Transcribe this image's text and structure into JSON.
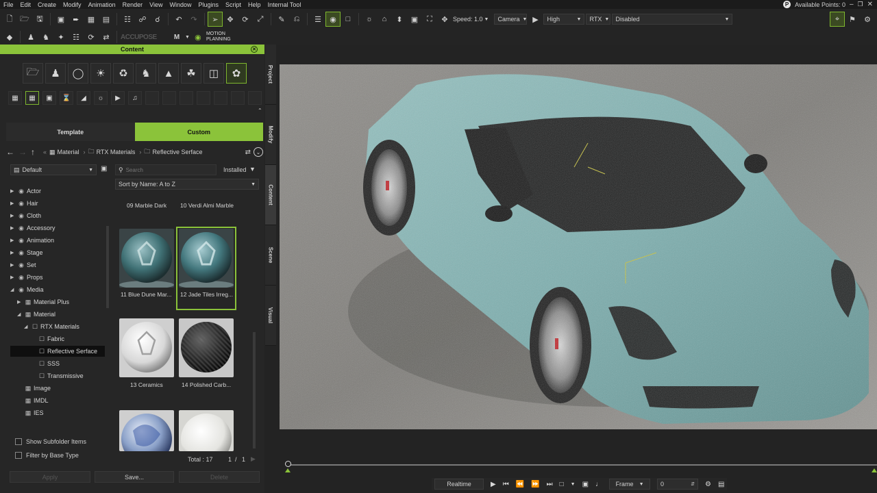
{
  "menu": [
    "File",
    "Edit",
    "Create",
    "Modify",
    "Animation",
    "Render",
    "View",
    "Window",
    "Plugins",
    "Script",
    "Help",
    "Internal Tool"
  ],
  "available_points": "Available Points: 0",
  "toolbar": {
    "speed_label": "Speed: 1.0",
    "camera": "Camera",
    "quality": "High",
    "renderer": "RTX",
    "mode": "Disabled",
    "acupose": "ACCUPOSE",
    "motion_planning": "MOTION\nPLANNING"
  },
  "panel": {
    "title": "Content",
    "tabs": [
      "Template",
      "Custom"
    ],
    "active_tab": "Custom",
    "breadcrumb": [
      "Material",
      "RTX Materials",
      "Reflective Serface"
    ],
    "filter_select": "Default",
    "search_placeholder": "Search",
    "installed_label": "Installed",
    "sort_label": "Sort by Name: A to Z",
    "tree": [
      {
        "label": "Actor",
        "indent": 0,
        "expanded": false
      },
      {
        "label": "Hair",
        "indent": 0,
        "expanded": false
      },
      {
        "label": "Cloth",
        "indent": 0,
        "expanded": false
      },
      {
        "label": "Accessory",
        "indent": 0,
        "expanded": false
      },
      {
        "label": "Animation",
        "indent": 0,
        "expanded": false
      },
      {
        "label": "Stage",
        "indent": 0,
        "expanded": false
      },
      {
        "label": "Set",
        "indent": 0,
        "expanded": false
      },
      {
        "label": "Props",
        "indent": 0,
        "expanded": false
      },
      {
        "label": "Media",
        "indent": 0,
        "expanded": true
      },
      {
        "label": "Material Plus",
        "indent": 1,
        "expanded": false
      },
      {
        "label": "Material",
        "indent": 1,
        "expanded": true
      },
      {
        "label": "RTX Materials",
        "indent": 2,
        "expanded": true
      },
      {
        "label": "Fabric",
        "indent": 3
      },
      {
        "label": "Reflective Serface",
        "indent": 3,
        "selected": true
      },
      {
        "label": "SSS",
        "indent": 3
      },
      {
        "label": "Transmissive",
        "indent": 3
      },
      {
        "label": "Image",
        "indent": 1
      },
      {
        "label": "IMDL",
        "indent": 1
      },
      {
        "label": "IES",
        "indent": 1
      }
    ],
    "items": [
      {
        "label": "09 Marble Dark"
      },
      {
        "label": "10 Verdi Almi Marble"
      },
      {
        "label": "11 Blue Dune Mar..."
      },
      {
        "label": "12 Jade Tiles Irreg...",
        "selected": true
      },
      {
        "label": "13 Ceramics"
      },
      {
        "label": "14 Polished Carb..."
      },
      {
        "label": ""
      },
      {
        "label": ""
      }
    ],
    "total_label": "Total : 17",
    "page_current": "1",
    "page_sep": "/",
    "page_total": "1",
    "show_subfolder": "Show Subfolder Items",
    "filter_base": "Filter by Base Type",
    "apply_button": "Apply",
    "save_button": "Save...",
    "delete_button": "Delete"
  },
  "side_tabs": [
    "Project",
    "Modify",
    "Content",
    "Scene",
    "Visual"
  ],
  "timeline": {
    "realtime": "Realtime",
    "frame_label": "Frame",
    "frame_value": "0"
  },
  "colors": {
    "accent": "#8bc33a",
    "car_body": "#7fb3b2"
  }
}
